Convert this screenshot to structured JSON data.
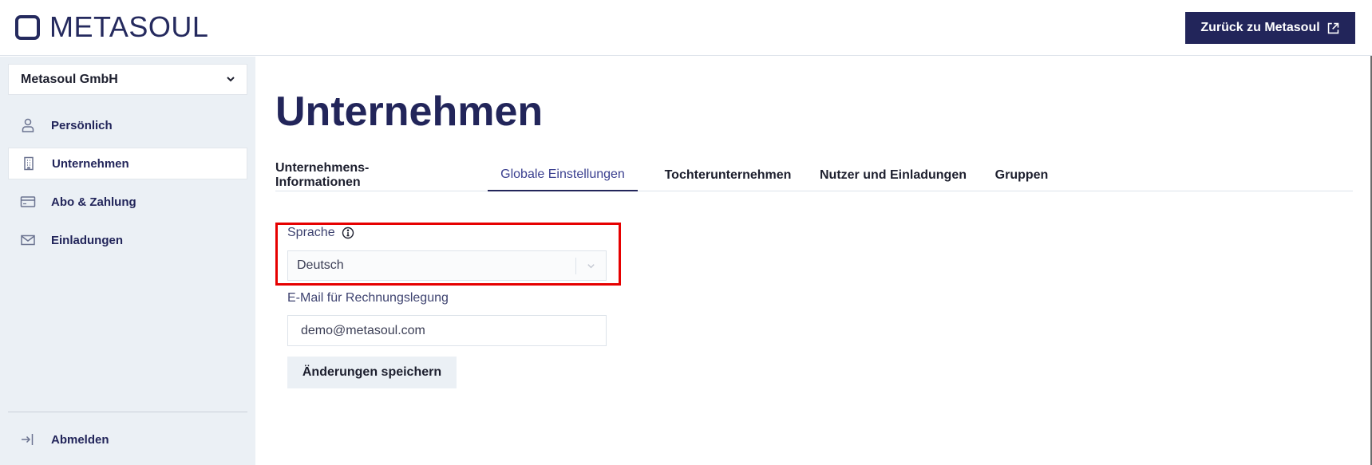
{
  "brand": {
    "logo_text": "METASOUL"
  },
  "header": {
    "back_button_label": "Zurück zu Metasoul",
    "back_button_icon": "external-link-icon"
  },
  "sidebar": {
    "company_select": "Metasoul GmbH",
    "items": [
      {
        "label": "Persönlich",
        "icon": "user-icon",
        "active": false
      },
      {
        "label": "Unternehmen",
        "icon": "building-icon",
        "active": true
      },
      {
        "label": "Abo & Zahlung",
        "icon": "credit-card-icon",
        "active": false
      },
      {
        "label": "Einladungen",
        "icon": "mail-icon",
        "active": false
      }
    ],
    "logout_label": "Abmelden"
  },
  "main": {
    "title": "Unternehmen",
    "tabs": [
      {
        "label": "Unternehmens-Informationen",
        "active": false
      },
      {
        "label": "Globale Einstellungen",
        "active": true
      },
      {
        "label": "Tochterunternehmen",
        "active": false
      },
      {
        "label": "Nutzer und Einladungen",
        "active": false
      },
      {
        "label": "Gruppen",
        "active": false
      }
    ],
    "language_label": "Sprache",
    "language_value": "Deutsch",
    "email_label": "E-Mail für Rechnungslegung",
    "email_value": "demo@metasoul.com",
    "save_label": "Änderungen speichern"
  },
  "colors": {
    "primary": "#22255a",
    "sidebar_bg": "#ebf0f5",
    "highlight": "#e60000"
  }
}
